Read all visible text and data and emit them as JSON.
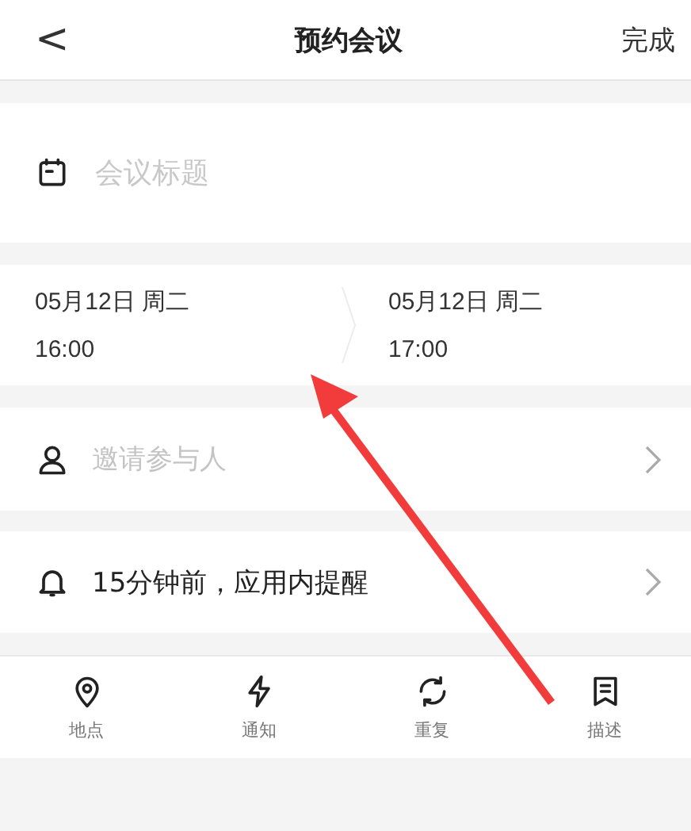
{
  "header": {
    "back": "<",
    "title": "预约会议",
    "action": "完成"
  },
  "title_field": {
    "placeholder": "会议标题"
  },
  "time": {
    "start": {
      "date": "05月12日 周二",
      "time": "16:00"
    },
    "end": {
      "date": "05月12日 周二",
      "time": "17:00"
    }
  },
  "rows": [
    {
      "kind": "invite",
      "text": "邀请参与人",
      "placeholder": true
    },
    {
      "kind": "reminder",
      "text": "15分钟前，应用内提醒",
      "placeholder": false
    }
  ],
  "toolbar": [
    {
      "kind": "location",
      "label": "地点"
    },
    {
      "kind": "notify",
      "label": "通知"
    },
    {
      "kind": "repeat",
      "label": "重复"
    },
    {
      "kind": "description",
      "label": "描述"
    }
  ]
}
